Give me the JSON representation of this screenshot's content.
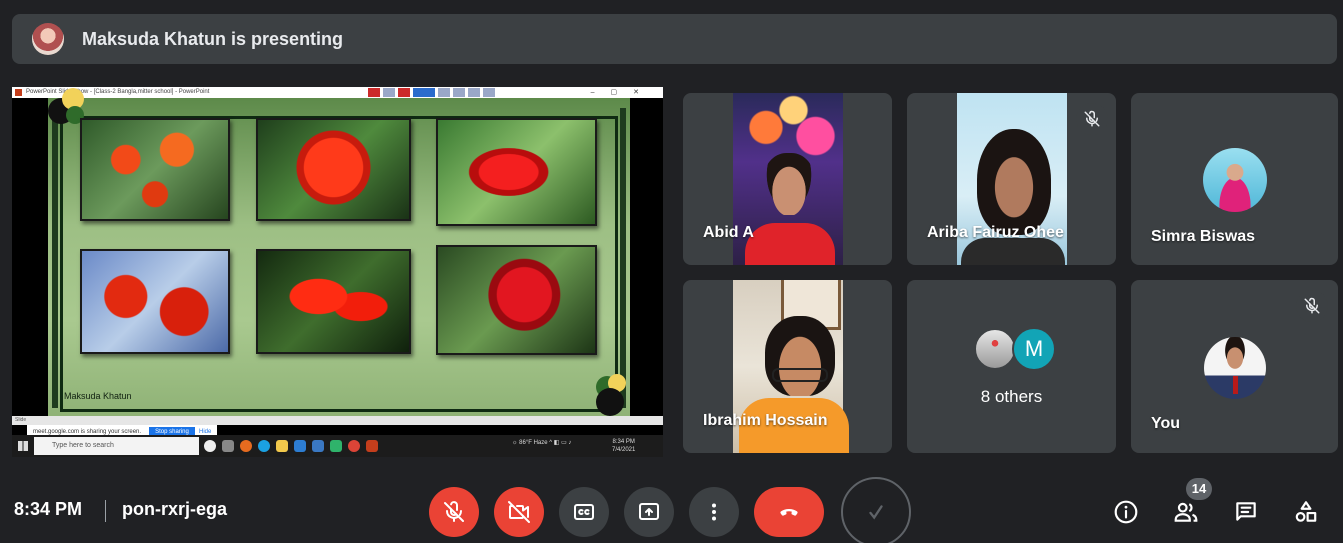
{
  "banner": {
    "text": "Maksuda Khatun is presenting"
  },
  "screen": {
    "window_title": "PowerPoint Slide Show - [Class-2 Bangla,mitter school] - PowerPoint",
    "slide_author": "Maksuda Khatun",
    "share_notice": "meet.google.com is sharing your screen.",
    "stop_label": "Stop sharing",
    "hide_label": "Hide",
    "status_text": "Slide",
    "search_placeholder": "Type here to search",
    "weather": "86°F  Haze",
    "clock_time": "8:34 PM",
    "clock_date": "7/4/2021"
  },
  "participants": [
    {
      "name": "Abid A",
      "muted": false
    },
    {
      "name": "Ariba Fairuz Ohee",
      "muted": true
    },
    {
      "name": "Simra Biswas",
      "muted": false
    },
    {
      "name": "Ibrahim Hossain",
      "muted": false
    },
    {
      "name": "You",
      "muted": true
    }
  ],
  "others": {
    "initial": "M",
    "label": "8 others"
  },
  "bottom": {
    "time": "8:34 PM",
    "code": "pon-rxrj-ega",
    "people_count": "14"
  },
  "colors": {
    "background": "#202124",
    "tile": "#3c4043",
    "danger": "#ea4335"
  }
}
